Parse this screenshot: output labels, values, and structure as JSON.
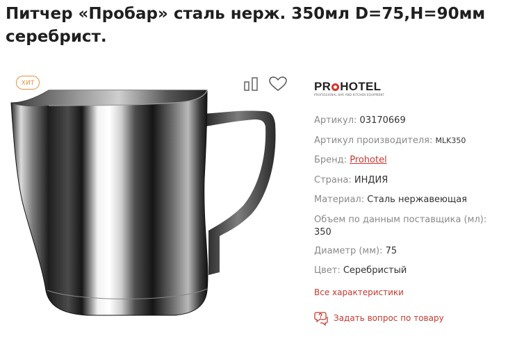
{
  "product": {
    "title": "Питчер «Пробар» сталь нерж. 350мл D=75,H=90мм серебрист.",
    "badge": "ХИТ"
  },
  "brand_logo": {
    "text_before": "PR",
    "text_after": "HOTEL",
    "tagline": "PROFESSIONAL BAR AND KITCHEN EQUIPMENT"
  },
  "specs": [
    {
      "label": "Артикул:",
      "value": "03170669"
    },
    {
      "label": "Артикул производителя:",
      "value": "MLK350"
    },
    {
      "label": "Бренд:",
      "value": "Prohotel"
    },
    {
      "label": "Страна:",
      "value": "ИНДИЯ"
    },
    {
      "label": "Материал:",
      "value": "Сталь нержавеющая"
    },
    {
      "label": "Объем по данным поставщика (мл):",
      "value": "350"
    },
    {
      "label": "Диаметр (мм):",
      "value": "75"
    },
    {
      "label": "Цвет:",
      "value": "Серебристый"
    }
  ],
  "links": {
    "all_specs": "Все характеристики",
    "ask_question": "Задать вопрос по товару"
  },
  "icons": {
    "compare": "compare-icon",
    "favorite": "heart-icon",
    "ask": "chat-question-icon"
  },
  "colors": {
    "accent": "#c6382e",
    "badge": "#e8913e",
    "logo_red": "#d9322b"
  }
}
